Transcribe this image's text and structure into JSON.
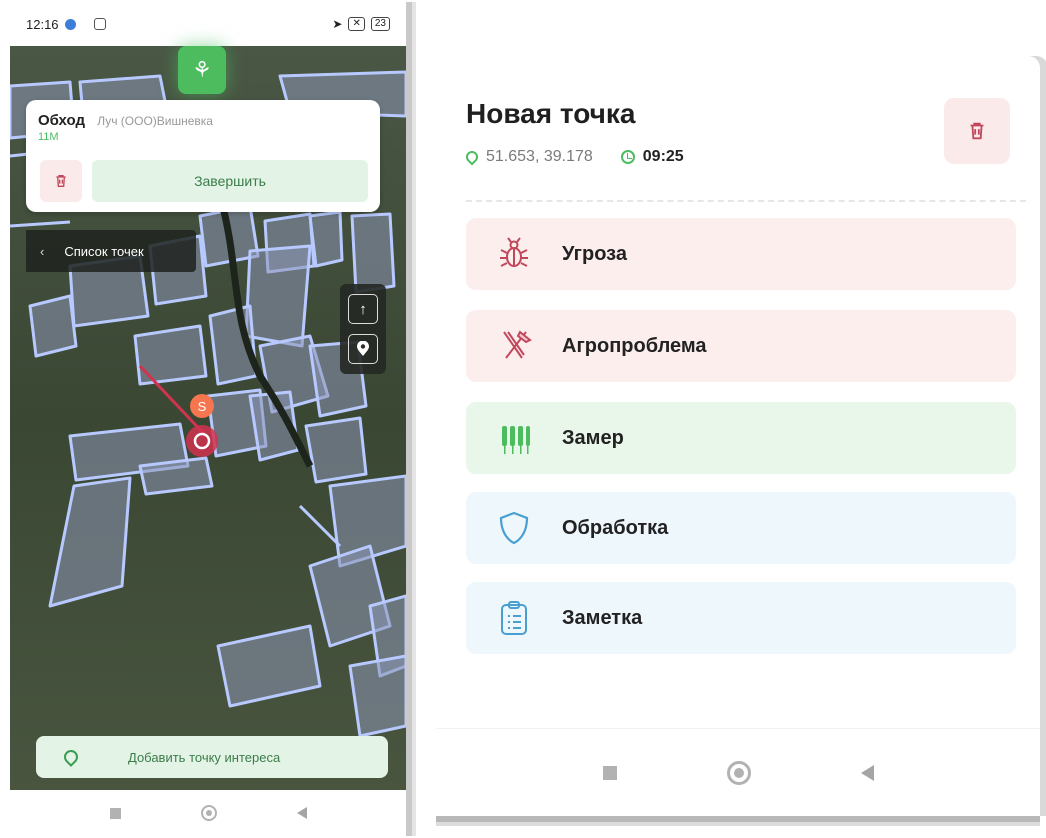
{
  "status_bar": {
    "time": "12:16",
    "battery": "23"
  },
  "walk_card": {
    "title": "Обход",
    "farm": "Луч (ООО)Вишневка",
    "distance": "11М",
    "finish_label": "Завершить"
  },
  "points_list_label": "Список точек",
  "map_marker_label": "S",
  "add_poi_label": "Добавить точку интереса",
  "new_point": {
    "title": "Новая точка",
    "coords": "51.653, 39.178",
    "time": "09:25"
  },
  "categories": [
    {
      "label": "Угроза",
      "icon": "bug-icon"
    },
    {
      "label": "Агропроблема",
      "icon": "tools-icon"
    },
    {
      "label": "Замер",
      "icon": "wheat-icon"
    },
    {
      "label": "Обработка",
      "icon": "shield-icon"
    },
    {
      "label": "Заметка",
      "icon": "clipboard-icon"
    }
  ],
  "colors": {
    "brand_green": "#4cbc5f",
    "danger": "#c0475c",
    "field_outline": "#a9c3ff"
  }
}
